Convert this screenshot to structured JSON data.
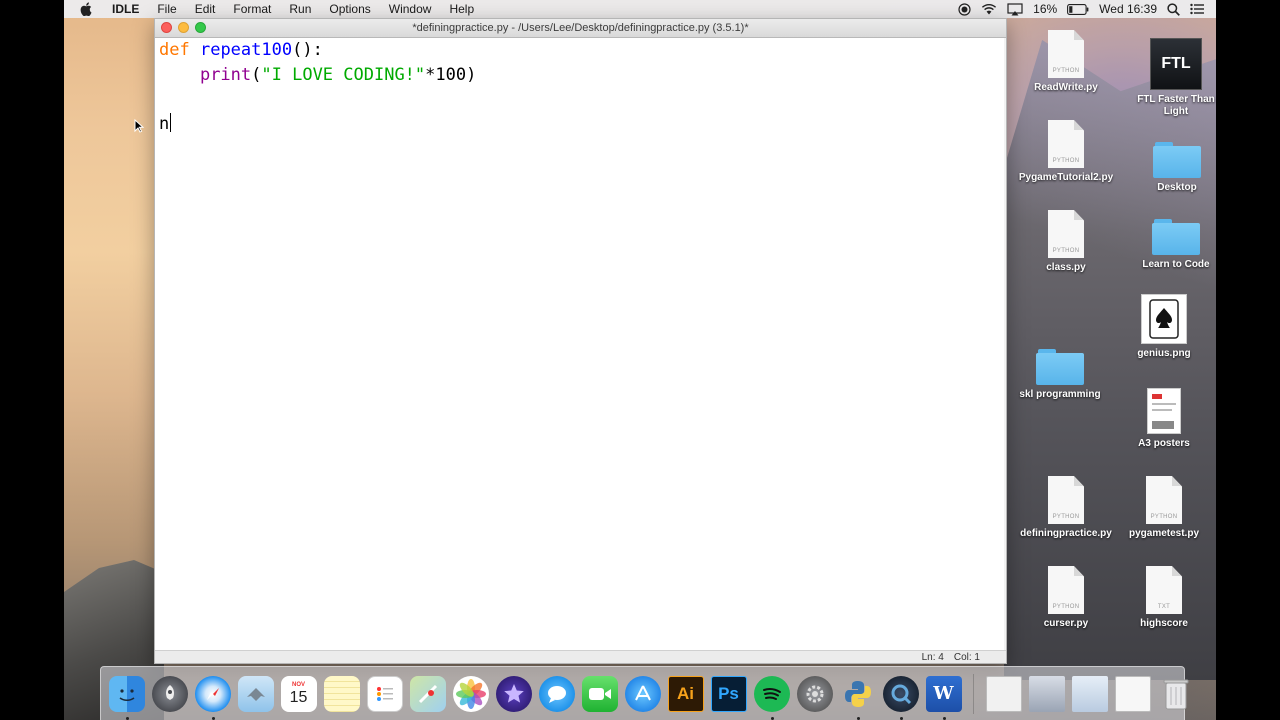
{
  "menubar": {
    "app_name": "IDLE",
    "items": [
      "File",
      "Edit",
      "Format",
      "Run",
      "Options",
      "Window",
      "Help"
    ],
    "battery_percent": "16%",
    "clock": "Wed 16:39"
  },
  "window": {
    "title": "*definingpractice.py - /Users/Lee/Desktop/definingpractice.py (3.5.1)*",
    "code": {
      "line1": {
        "kw": "def",
        "fn": "repeat100",
        "rest": "():"
      },
      "line2": {
        "indent": "    ",
        "builtin": "print",
        "open": "(",
        "string": "\"I LOVE CODING!\"",
        "rest": "*100)"
      },
      "line3": "",
      "line4": "n"
    },
    "status": {
      "line": "Ln: 4",
      "col": "Col: 1"
    }
  },
  "desktop_icons": [
    {
      "label": "ReadWrite.py",
      "type": "python",
      "tag": "PYTHON"
    },
    {
      "label": "FTL Faster Than Light",
      "type": "app",
      "tag": "FTL"
    },
    {
      "label": "PygameTutorial2.py",
      "type": "python",
      "tag": "PYTHON"
    },
    {
      "label": "Desktop",
      "type": "folder"
    },
    {
      "label": "class.py",
      "type": "python",
      "tag": "PYTHON"
    },
    {
      "label": "Learn to Code",
      "type": "folder"
    },
    {
      "label": "genius.png",
      "type": "image"
    },
    {
      "label": "skl programming",
      "type": "folder"
    },
    {
      "label": "A3 posters",
      "type": "poster"
    },
    {
      "label": "definingpractice.py",
      "type": "python",
      "tag": "PYTHON"
    },
    {
      "label": "pygametest.py",
      "type": "python",
      "tag": "PYTHON"
    },
    {
      "label": "curser.py",
      "type": "python",
      "tag": "PYTHON"
    },
    {
      "label": "highscore",
      "type": "text",
      "tag": "TXT"
    }
  ],
  "dock": {
    "calendar_month": "NOV",
    "calendar_day": "15",
    "apps": [
      "finder",
      "launchpad",
      "safari",
      "mail",
      "calendar",
      "notes",
      "reminders",
      "maps",
      "photos",
      "imovie",
      "messages",
      "facetime",
      "app-store",
      "illustrator",
      "photoshop",
      "spotify",
      "system-preferences",
      "python-launcher",
      "quicktime",
      "word"
    ],
    "illustrator_label": "Ai",
    "photoshop_label": "Ps",
    "word_label": "W"
  },
  "colors": {
    "keyword": "#ff7700",
    "definition": "#0000ff",
    "builtin": "#900090",
    "string": "#00aa00"
  }
}
